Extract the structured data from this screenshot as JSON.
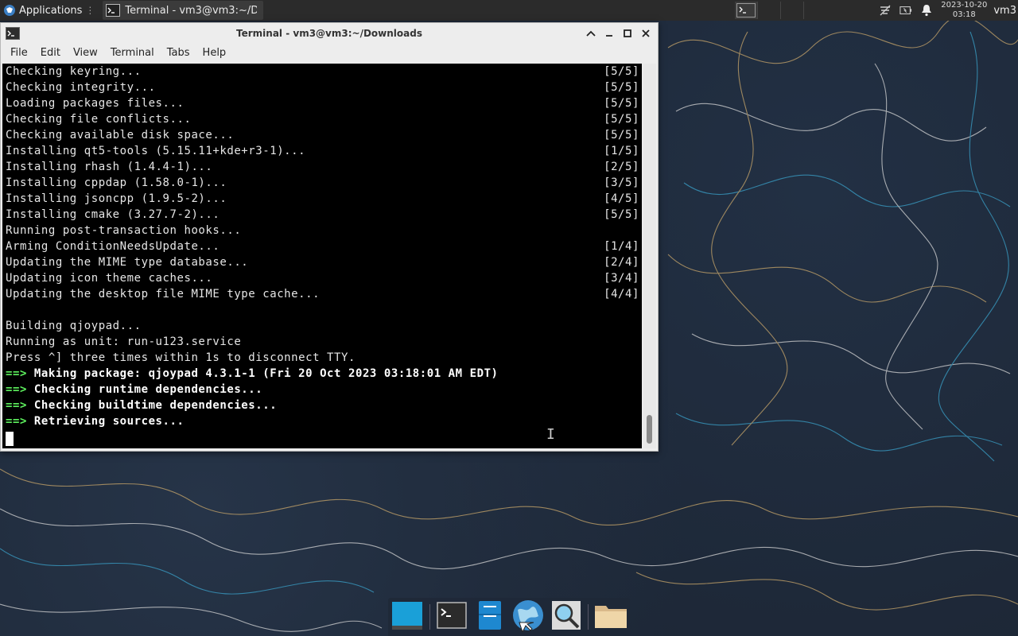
{
  "panel": {
    "apps_label": "Applications",
    "task_label": "Terminal - vm3@vm3:~/D...",
    "date": "2023-10-20",
    "time": "03:18",
    "user": "vm3"
  },
  "window": {
    "title": "Terminal - vm3@vm3:~/Downloads",
    "menu": [
      "File",
      "Edit",
      "View",
      "Terminal",
      "Tabs",
      "Help"
    ]
  },
  "terminal": {
    "lines": [
      {
        "text": "Checking keyring...",
        "progress": "[5/5]"
      },
      {
        "text": "Checking integrity...",
        "progress": "[5/5]"
      },
      {
        "text": "Loading packages files...",
        "progress": "[5/5]"
      },
      {
        "text": "Checking file conflicts...",
        "progress": "[5/5]"
      },
      {
        "text": "Checking available disk space...",
        "progress": "[5/5]"
      },
      {
        "text": "Installing qt5-tools (5.15.11+kde+r3-1)...",
        "progress": "[1/5]"
      },
      {
        "text": "Installing rhash (1.4.4-1)...",
        "progress": "[2/5]"
      },
      {
        "text": "Installing cppdap (1.58.0-1)...",
        "progress": "[3/5]"
      },
      {
        "text": "Installing jsoncpp (1.9.5-2)...",
        "progress": "[4/5]"
      },
      {
        "text": "Installing cmake (3.27.7-2)...",
        "progress": "[5/5]"
      },
      {
        "text": "Running post-transaction hooks...",
        "progress": ""
      },
      {
        "text": "Arming ConditionNeedsUpdate...",
        "progress": "[1/4]"
      },
      {
        "text": "Updating the MIME type database...",
        "progress": "[2/4]"
      },
      {
        "text": "Updating icon theme caches...",
        "progress": "[3/4]"
      },
      {
        "text": "Updating the desktop file MIME type cache...",
        "progress": "[4/4]"
      },
      {
        "text": "",
        "progress": ""
      },
      {
        "text": "Building qjoypad...",
        "progress": ""
      },
      {
        "text": "Running as unit: run-u123.service",
        "progress": ""
      },
      {
        "text": "Press ^] three times within 1s to disconnect TTY.",
        "progress": ""
      }
    ],
    "arrow": "==>",
    "bold_lines": [
      "Making package: qjoypad 4.3.1-1 (Fri 20 Oct 2023 03:18:01 AM EDT)",
      "Checking runtime dependencies...",
      "Checking buildtime dependencies...",
      "Retrieving sources..."
    ]
  },
  "colors": {
    "arrow": "#5ef25e",
    "terminal_bg": "#000000",
    "panel_bg": "#2b2b2b"
  },
  "icons": {
    "apps": "xfce-logo-icon",
    "dock": [
      "desktop-icon",
      "terminal-icon",
      "file-manager-icon",
      "web-browser-icon",
      "search-icon",
      "folder-icon"
    ]
  }
}
